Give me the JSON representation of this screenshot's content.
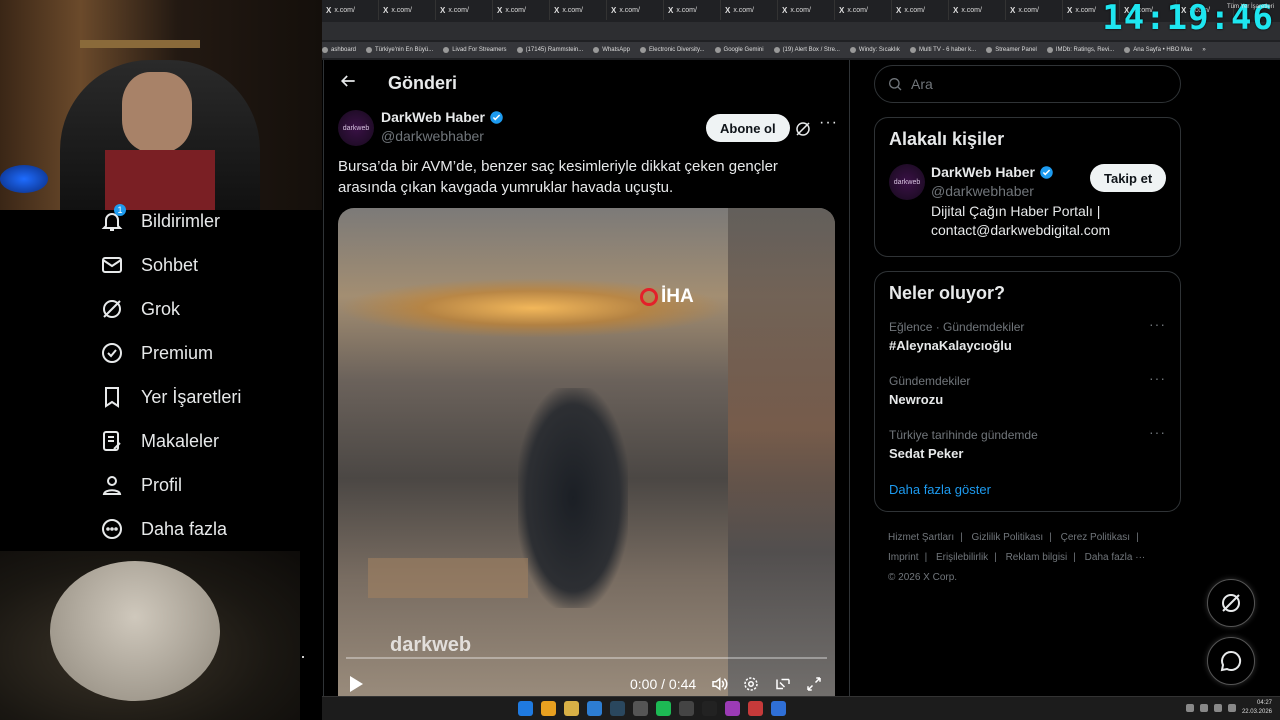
{
  "browser": {
    "tabs": [
      "x.com/",
      "x.com/",
      "x.com/",
      "x.com/",
      "x.com/",
      "x.com/",
      "x.com/",
      "x.com/",
      "x.com/",
      "x.com/",
      "x.com/",
      "x.com/",
      "x.com/",
      "x.com/",
      "x.com/",
      "x.com/"
    ],
    "tab_icon": "X",
    "bookmarks": [
      "ashboard",
      "Türkiye'nin En Büyü...",
      "Livad For Streamers",
      "(17145) Rammstein...",
      "WhatsApp",
      "Electronic Diversity...",
      "Google Gemini",
      "(19) Alert Box / Stre...",
      "Windy: Sıcaklık",
      "Multi TV - 6 haber k...",
      "Streamer Panel",
      "IMDb: Ratings, Revi...",
      "Ana Sayfa • HBO Max"
    ],
    "bookmarks_more": "»",
    "all_bookmarks": "Tüm Yer İşaretleri"
  },
  "overlay": {
    "clock": "14:19:46"
  },
  "nav": {
    "items": [
      {
        "label": "Bildirimler",
        "icon": "bell-icon",
        "badge": "1"
      },
      {
        "label": "Sohbet",
        "icon": "envelope-icon"
      },
      {
        "label": "Grok",
        "icon": "grok-icon"
      },
      {
        "label": "Premium",
        "icon": "verified-icon"
      },
      {
        "label": "Yer İşaretleri",
        "icon": "bookmark-icon"
      },
      {
        "label": "Makaleler",
        "icon": "article-icon"
      },
      {
        "label": "Profil",
        "icon": "person-icon"
      },
      {
        "label": "Daha fazla",
        "icon": "more-circle-icon"
      }
    ]
  },
  "main": {
    "title": "Gönderi",
    "post": {
      "author": "DarkWeb Haber",
      "handle": "@darkwebhaber",
      "avatar_text": "darkweb",
      "follow_label": "Abone ol",
      "more": "···",
      "text": "Bursa’da bir AVM’de, benzer saç kesimleriyle dikkat çeken gençler arasında çıkan kavgada yumruklar havada uçuştu.",
      "video": {
        "logo": "İHA",
        "watermark": "darkweb",
        "time": "0:00 / 0:44",
        "progress": 0.0
      }
    }
  },
  "sidebar": {
    "search_placeholder": "Ara",
    "related": {
      "title": "Alakalı kişiler",
      "name": "DarkWeb Haber",
      "handle": "@darkwebhaber",
      "bio": "Dijital Çağın Haber Portalı | contact@darkwebdigital.com",
      "follow_label": "Takip et"
    },
    "trends": {
      "title": "Neler oluyor?",
      "items": [
        {
          "context": "Eğlence · Gündemdekiler",
          "topic": "#AleynaKalaycıoğlu"
        },
        {
          "context": "Gündemdekiler",
          "topic": "Newrozu"
        },
        {
          "context": "Türkiye tarihinde gündemde",
          "topic": "Sedat Peker"
        }
      ],
      "more_dots": "···",
      "show_more": "Daha fazla göster"
    },
    "footer": {
      "links": [
        "Hizmet Şartları",
        "Gizlilik Politikası",
        "Çerez Politikası",
        "Imprint",
        "Erişilebilirlik",
        "Reklam bilgisi",
        "Daha fazla ···"
      ],
      "copyright": "© 2026 X Corp."
    }
  },
  "taskbar": {
    "time": "04:27",
    "date": "22.03.2026"
  },
  "colors": {
    "accent": "#1d9bf0",
    "background": "#000000",
    "clock": "#1ee6f0",
    "border": "#2f3336"
  }
}
